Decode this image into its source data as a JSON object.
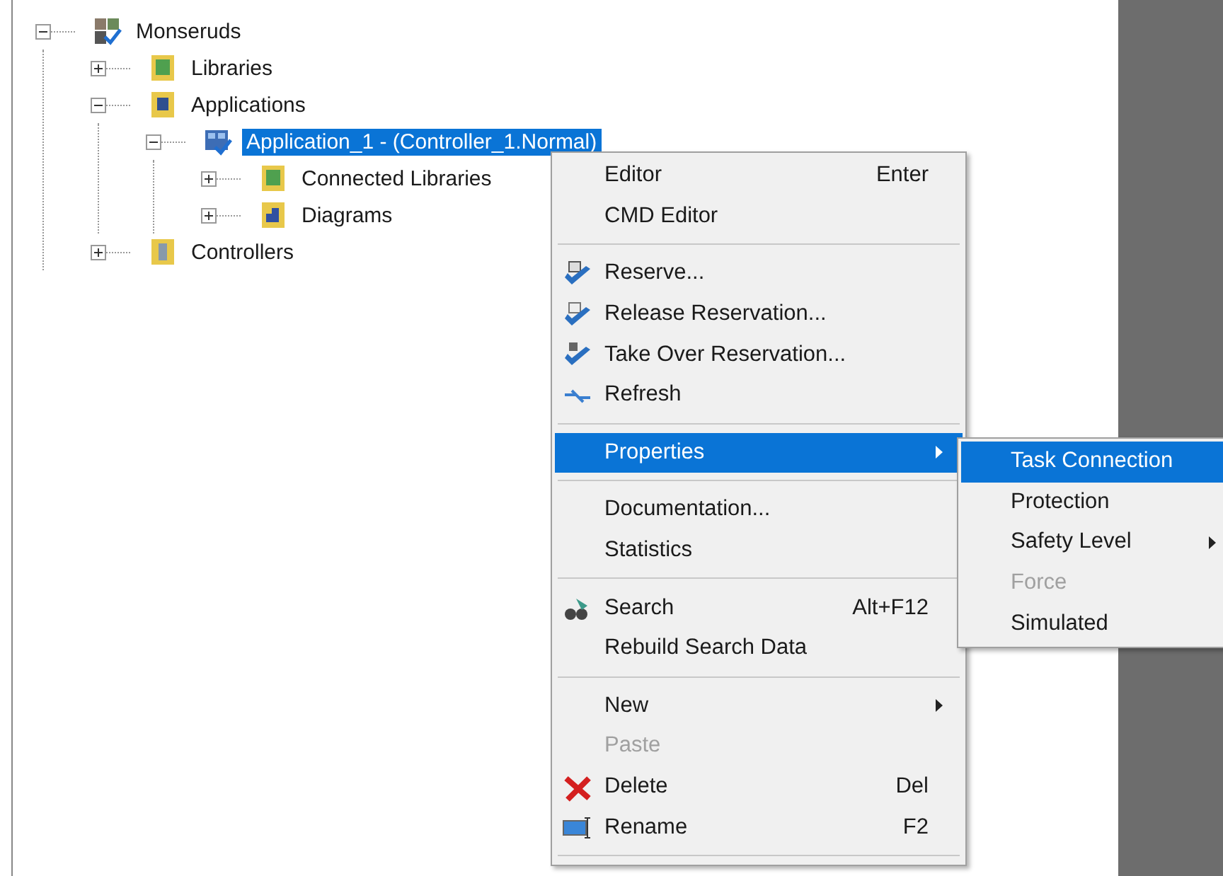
{
  "tree": [
    {
      "label": "Monseruds",
      "kind": "system",
      "expanded": true,
      "selected": false,
      "children": [
        {
          "label": "Libraries",
          "kind": "library",
          "expanded": false,
          "selected": false
        },
        {
          "label": "Applications",
          "kind": "applications",
          "expanded": true,
          "selected": false,
          "children": [
            {
              "label": "Application_1 - (Controller_1.Normal)",
              "kind": "application",
              "expanded": true,
              "selected": true,
              "children": [
                {
                  "label": "Connected Libraries",
                  "kind": "library",
                  "expanded": false,
                  "selected": false
                },
                {
                  "label": "Diagrams",
                  "kind": "diagrams",
                  "expanded": false,
                  "selected": false
                }
              ]
            }
          ]
        },
        {
          "label": "Controllers",
          "kind": "controllers",
          "expanded": false,
          "selected": false
        }
      ]
    }
  ],
  "context_menu": [
    {
      "kind": "plain",
      "label": "Editor",
      "shortcut": "Enter",
      "disabled": false,
      "selected": false,
      "submenu": false
    },
    {
      "kind": "plain",
      "label": "CMD Editor",
      "disabled": false,
      "selected": false,
      "submenu": false
    },
    {
      "kind": "separator"
    },
    {
      "kind": "reserve",
      "label": "Reserve...",
      "disabled": false,
      "selected": false,
      "submenu": false
    },
    {
      "kind": "release",
      "label": "Release Reservation...",
      "disabled": false,
      "selected": false,
      "submenu": false
    },
    {
      "kind": "takeover",
      "label": "Take Over Reservation...",
      "disabled": false,
      "selected": false,
      "submenu": false
    },
    {
      "kind": "refresh",
      "label": "Refresh",
      "disabled": false,
      "selected": false,
      "submenu": false
    },
    {
      "kind": "separator"
    },
    {
      "kind": "plain",
      "label": "Properties",
      "disabled": false,
      "selected": true,
      "submenu": true
    },
    {
      "kind": "separator"
    },
    {
      "kind": "plain",
      "label": "Documentation...",
      "disabled": false,
      "selected": false,
      "submenu": false
    },
    {
      "kind": "plain",
      "label": "Statistics",
      "disabled": false,
      "selected": false,
      "submenu": false
    },
    {
      "kind": "separator"
    },
    {
      "kind": "search",
      "label": "Search",
      "shortcut": "Alt+F12",
      "disabled": false,
      "selected": false,
      "submenu": false
    },
    {
      "kind": "plain",
      "label": "Rebuild Search Data",
      "disabled": false,
      "selected": false,
      "submenu": false
    },
    {
      "kind": "separator"
    },
    {
      "kind": "plain",
      "label": "New",
      "disabled": false,
      "selected": false,
      "submenu": true
    },
    {
      "kind": "plain",
      "label": "Paste",
      "disabled": true,
      "selected": false,
      "submenu": false
    },
    {
      "kind": "delete",
      "label": "Delete",
      "shortcut": "Del",
      "disabled": false,
      "selected": false,
      "submenu": false
    },
    {
      "kind": "rename",
      "label": "Rename",
      "shortcut": "F2",
      "disabled": false,
      "selected": false,
      "submenu": false
    },
    {
      "kind": "separator"
    }
  ],
  "submenu": [
    {
      "label": "Task Connection",
      "disabled": false,
      "selected": true,
      "submenu": false
    },
    {
      "label": "Protection",
      "disabled": false,
      "selected": false,
      "submenu": false
    },
    {
      "label": "Safety Level",
      "disabled": false,
      "selected": false,
      "submenu": true
    },
    {
      "label": "Force",
      "disabled": true,
      "selected": false,
      "submenu": false
    },
    {
      "label": "Simulated",
      "disabled": false,
      "selected": false,
      "submenu": false
    }
  ]
}
